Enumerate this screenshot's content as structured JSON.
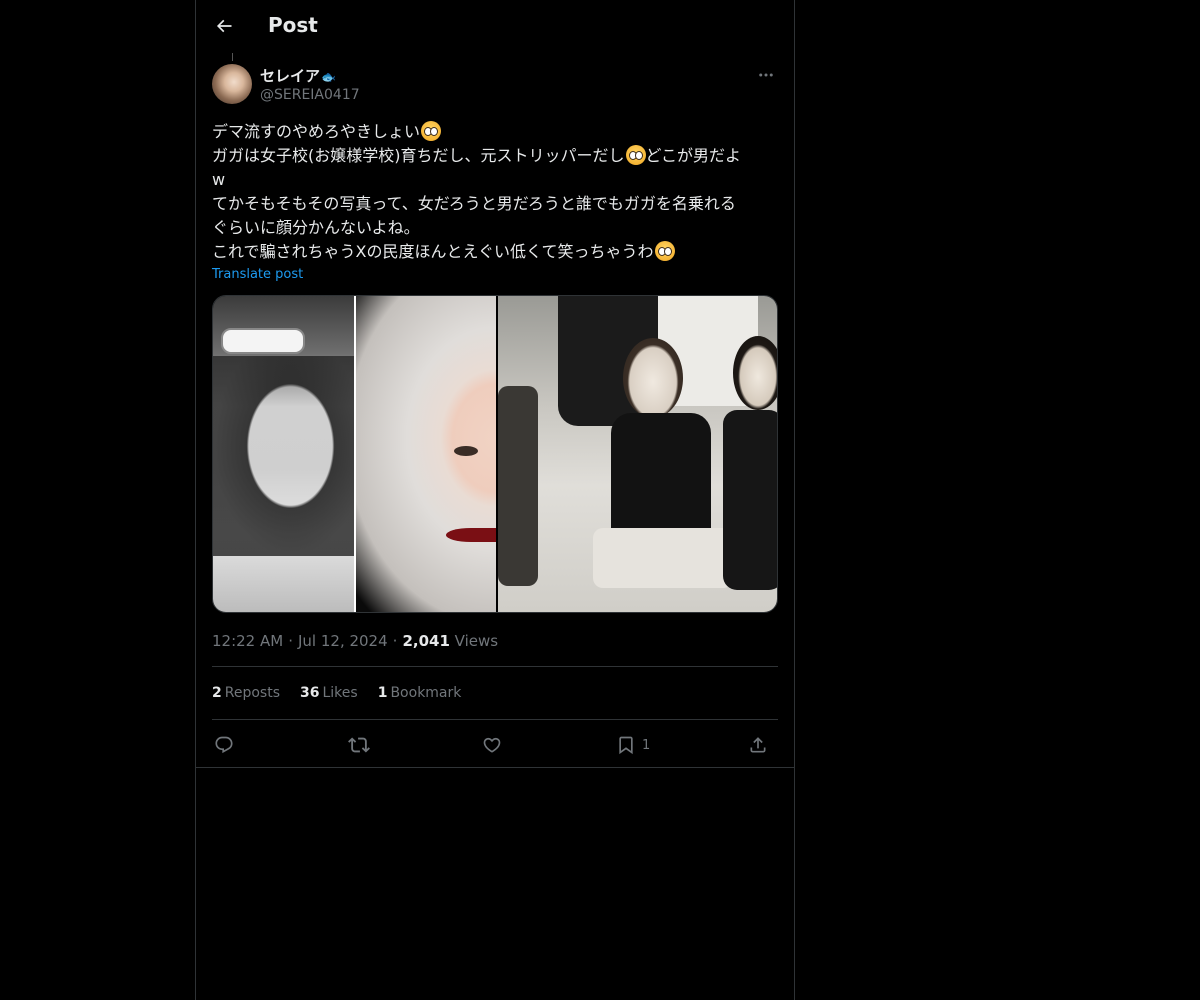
{
  "header": {
    "title": "Post"
  },
  "author": {
    "display_name": "セレイア",
    "name_emoji": "🐟",
    "handle": "@SEREIA0417"
  },
  "post": {
    "lines": [
      "デマ流すのやめろやきしょい",
      "ガガは女子校(お嬢様学校)育ちだし、元ストリッパーだし",
      "どこが男だよ",
      "w",
      "てかそもそもその写真って、女だろうと男だろうと誰でもガガを名乗れる",
      "ぐらいに顔分かんないよね。",
      "これで騙されちゃうXの民度ほんとえぐい低くて笑っちゃうわ"
    ],
    "translate_label": "Translate post"
  },
  "meta": {
    "time": "12:22 AM",
    "separator": "·",
    "date": "Jul 12, 2024",
    "views_count": "2,041",
    "views_label": "Views"
  },
  "stats": {
    "reposts_count": "2",
    "reposts_label": "Reposts",
    "likes_count": "36",
    "likes_label": "Likes",
    "bookmarks_count": "1",
    "bookmarks_label": "Bookmark"
  },
  "actions": {
    "reply_icon": "reply-icon",
    "repost_icon": "repost-icon",
    "like_icon": "heart-icon",
    "bookmark_icon": "bookmark-icon",
    "bookmark_count": "1",
    "share_icon": "share-icon"
  },
  "colors": {
    "background": "#000000",
    "text": "#e7e9ea",
    "muted": "#71767b",
    "accent": "#1d9bf0",
    "border": "#2f3336"
  }
}
